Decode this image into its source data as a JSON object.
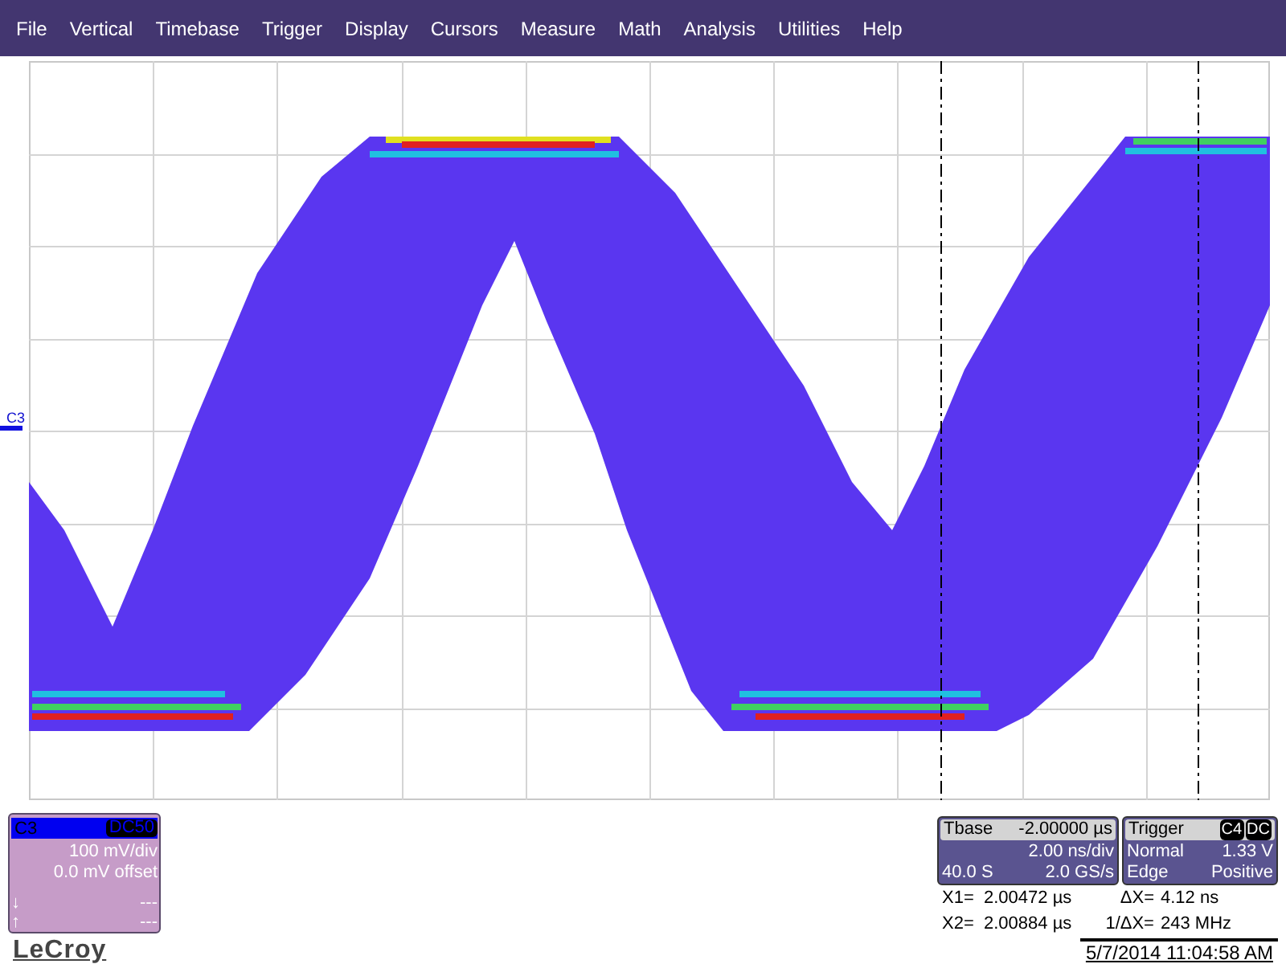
{
  "menu": [
    "File",
    "Vertical",
    "Timebase",
    "Trigger",
    "Display",
    "Cursors",
    "Measure",
    "Math",
    "Analysis",
    "Utilities",
    "Help"
  ],
  "screen": {
    "trace_label": "C3"
  },
  "channel": {
    "label": "C3",
    "coupling": "DC50",
    "scale": "100 mV/div",
    "offset": "0.0 mV offset",
    "rows": [
      {
        "symbol": "↓",
        "value": "---"
      },
      {
        "symbol": "↑",
        "value": "---"
      }
    ]
  },
  "brand": "LeCroy",
  "timebase": {
    "title": "Tbase",
    "delay": "-2.00000 µs",
    "scale": "2.00 ns/div",
    "samples": "40.0 S",
    "rate": "2.0 GS/s"
  },
  "trigger": {
    "title": "Trigger",
    "source": "C4",
    "coupling": "DC",
    "mode": "Normal",
    "level": "1.33 V",
    "type": "Edge",
    "slope": "Positive"
  },
  "cursors": [
    {
      "label": "X1=",
      "value": "2.00472 µs",
      "delta_label": "ΔX=",
      "delta_value": "4.12 ns"
    },
    {
      "label": "X2=",
      "value": "2.00884 µs",
      "delta_label": "1/ΔX=",
      "delta_value": "243 MHz"
    }
  ],
  "timestamp": "5/7/2014 11:04:58 AM"
}
